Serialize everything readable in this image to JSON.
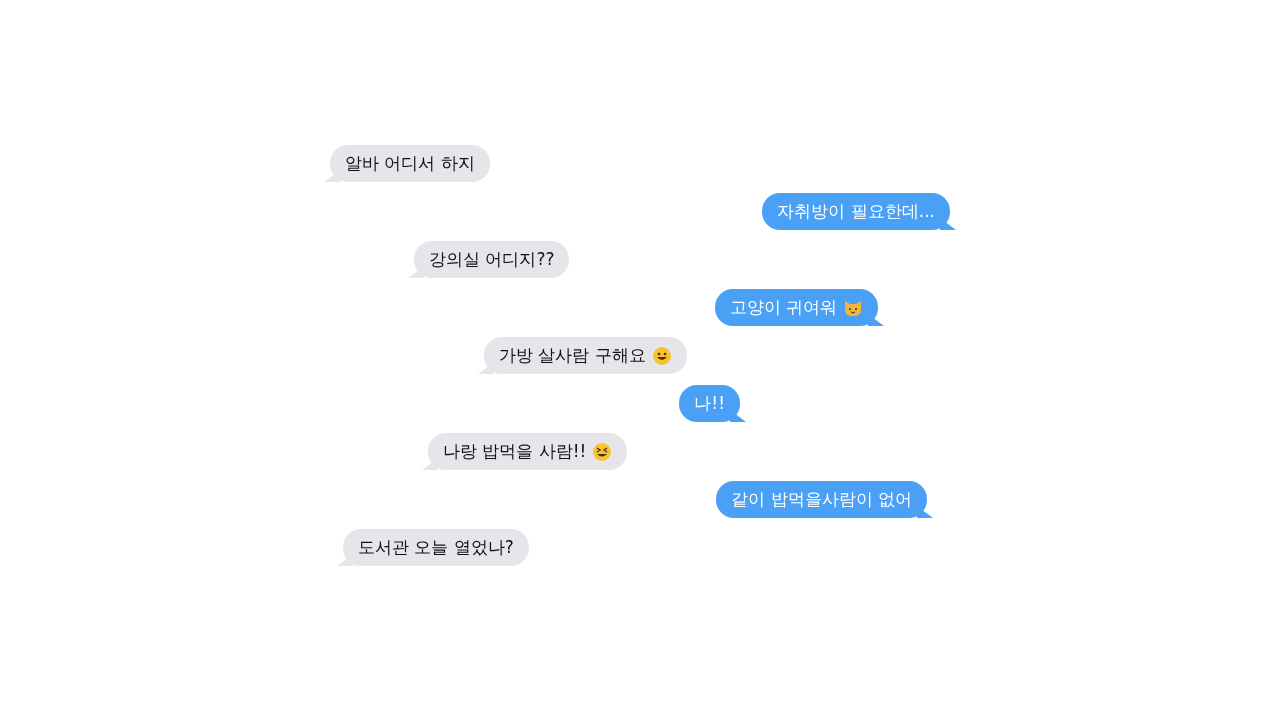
{
  "messages": [
    {
      "text": "알바 어디서 하지",
      "kind": "received"
    },
    {
      "text": "자취방이 필요한데...",
      "kind": "sent"
    },
    {
      "text": "강의실 어디지??",
      "kind": "received"
    },
    {
      "text": "고양이 귀여워",
      "kind": "sent"
    },
    {
      "text": "가방 살사람 구해요",
      "kind": "received"
    },
    {
      "text": "나!!",
      "kind": "sent"
    },
    {
      "text": "나랑 밥먹을 사람!!",
      "kind": "received"
    },
    {
      "text": "같이 밥먹을사람이 없어",
      "kind": "sent"
    },
    {
      "text": "도서관 오늘 열었나?",
      "kind": "received"
    }
  ]
}
